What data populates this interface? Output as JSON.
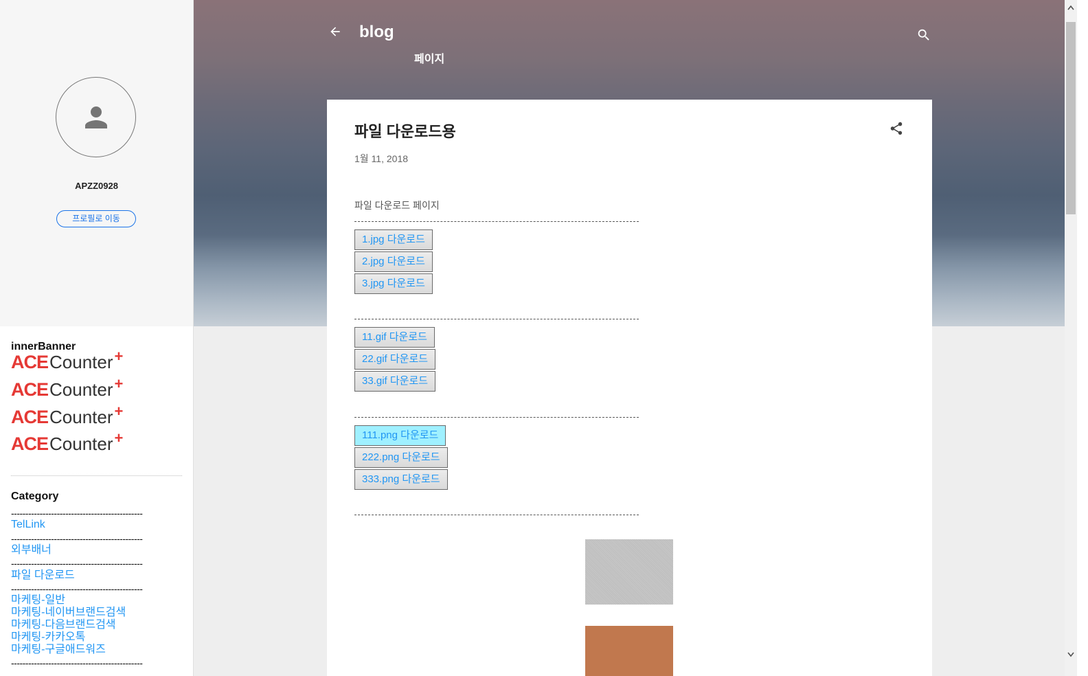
{
  "header": {
    "blog_title": "blog",
    "page_label": "페이지"
  },
  "profile": {
    "name": "APZZ0928",
    "button_label": "프로필로 이동"
  },
  "sidebar": {
    "banner_title": "innerBanner",
    "ace_banners": [
      {
        "brand_a": "ACE",
        "brand_b": "Counter",
        "plus": "+"
      },
      {
        "brand_a": "ACE",
        "brand_b": "Counter",
        "plus": "+"
      },
      {
        "brand_a": "ACE",
        "brand_b": "Counter",
        "plus": "+"
      },
      {
        "brand_a": "ACE",
        "brand_b": "Counter",
        "plus": "+"
      }
    ],
    "category_title": "Category",
    "dash_line": "----------------------------------------------",
    "categories": [
      "TelLink",
      "외부배너",
      "파일 다운로드"
    ],
    "marketing": [
      "마케팅-일반",
      "마케팅-네이버브랜드검색",
      "마케팅-다음브랜드검색",
      "마케팅-카카오톡",
      "마케팅-구글애드워즈"
    ]
  },
  "post": {
    "title": "파일 다운로드용",
    "date": "1월 11, 2018",
    "intro": "파일 다운로드 페이지",
    "jpg_downloads": [
      "1.jpg 다운로드",
      "2.jpg 다운로드",
      "3.jpg 다운로드"
    ],
    "gif_downloads": [
      "11.gif 다운로드",
      "22.gif 다운로드",
      "33.gif 다운로드"
    ],
    "png_downloads": [
      "111.png 다운로드",
      "222.png 다운로드",
      "333.png 다운로드"
    ]
  },
  "colors": {
    "link": "#2196f3",
    "accent": "#1a73e8",
    "brand_red": "#e53935",
    "active_button": "#9ff0ff"
  }
}
